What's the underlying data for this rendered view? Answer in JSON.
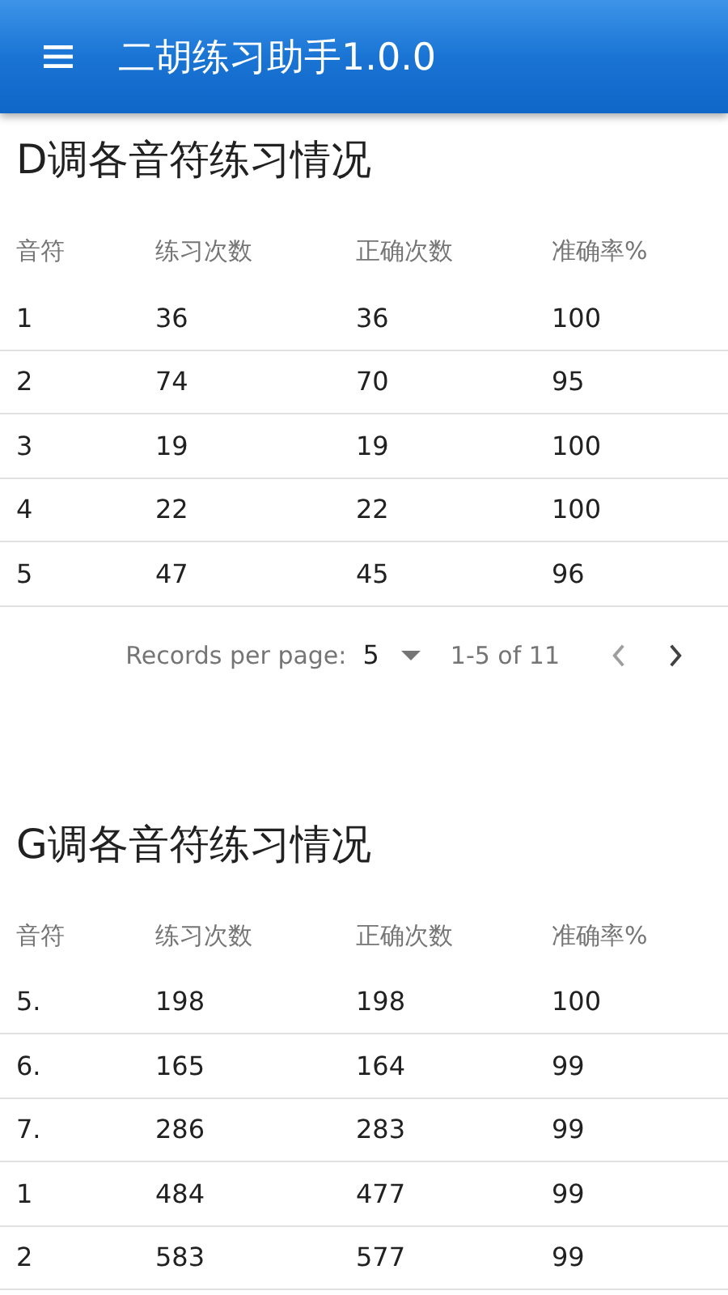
{
  "app_bar": {
    "title": "二胡练习助手1.0.0"
  },
  "sections": [
    {
      "title": "D调各音符练习情况",
      "columns": [
        "音符",
        "练习次数",
        "正确次数",
        "准确率%"
      ],
      "rows": [
        [
          "1",
          "36",
          "36",
          "100"
        ],
        [
          "2",
          "74",
          "70",
          "95"
        ],
        [
          "3",
          "19",
          "19",
          "100"
        ],
        [
          "4",
          "22",
          "22",
          "100"
        ],
        [
          "5",
          "47",
          "45",
          "96"
        ]
      ],
      "pagination": {
        "label": "Records per page:",
        "per_page": "5",
        "range": "1-5 of 11",
        "prev_disabled": true,
        "next_disabled": false
      }
    },
    {
      "title": "G调各音符练习情况",
      "columns": [
        "音符",
        "练习次数",
        "正确次数",
        "准确率%"
      ],
      "rows": [
        [
          "5.",
          "198",
          "198",
          "100"
        ],
        [
          "6.",
          "165",
          "164",
          "99"
        ],
        [
          "7.",
          "286",
          "283",
          "99"
        ],
        [
          "1",
          "484",
          "477",
          "99"
        ],
        [
          "2",
          "583",
          "577",
          "99"
        ]
      ]
    }
  ]
}
